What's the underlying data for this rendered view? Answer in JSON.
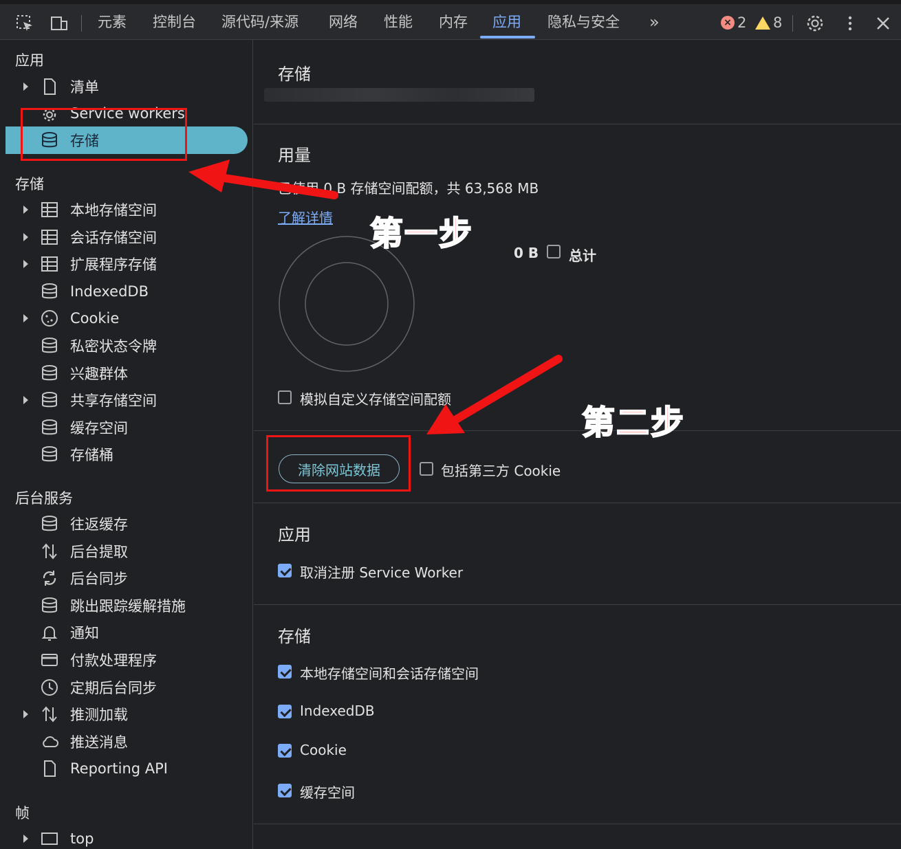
{
  "toolbar": {
    "tabs": [
      "元素",
      "控制台",
      "源代码/来源",
      "网络",
      "性能",
      "内存",
      "应用",
      "隐私与安全"
    ],
    "active_tab": "应用",
    "more_label": "»",
    "error_count": "2",
    "warning_count": "8",
    "colors": {
      "accent": "#7cacf8",
      "selected_bg": "#5fb4c9",
      "error": "#f28b82",
      "warning": "#fdd663"
    }
  },
  "sidebar": {
    "app_section": "应用",
    "app_items": [
      {
        "label": "清单",
        "icon": "file-icon"
      },
      {
        "label": "Service workers",
        "icon": "gear-icon"
      },
      {
        "label": "存储",
        "icon": "database-icon"
      }
    ],
    "storage_section": "存储",
    "storage_items": [
      {
        "label": "本地存储空间",
        "icon": "table-icon"
      },
      {
        "label": "会话存储空间",
        "icon": "table-icon"
      },
      {
        "label": "扩展程序存储",
        "icon": "table-icon"
      },
      {
        "label": "IndexedDB",
        "icon": "database-icon"
      },
      {
        "label": "Cookie",
        "icon": "cookie-icon"
      },
      {
        "label": "私密状态令牌",
        "icon": "database-icon"
      },
      {
        "label": "兴趣群体",
        "icon": "database-icon"
      },
      {
        "label": "共享存储空间",
        "icon": "database-icon"
      },
      {
        "label": "缓存空间",
        "icon": "database-icon"
      },
      {
        "label": "存储桶",
        "icon": "database-icon"
      }
    ],
    "bg_section": "后台服务",
    "bg_items": [
      {
        "label": "往返缓存",
        "icon": "database-icon"
      },
      {
        "label": "后台提取",
        "icon": "up-down-arrows-icon"
      },
      {
        "label": "后台同步",
        "icon": "sync-icon"
      },
      {
        "label": "跳出跟踪缓解措施",
        "icon": "database-icon"
      },
      {
        "label": "通知",
        "icon": "bell-icon"
      },
      {
        "label": "付款处理程序",
        "icon": "card-icon"
      },
      {
        "label": "定期后台同步",
        "icon": "clock-icon"
      },
      {
        "label": "推测加载",
        "icon": "up-down-arrows-icon"
      },
      {
        "label": "推送消息",
        "icon": "cloud-icon"
      },
      {
        "label": "Reporting API",
        "icon": "file-icon"
      }
    ],
    "frames_section": "帧",
    "frame_items": [
      {
        "label": "top",
        "icon": "window-icon"
      }
    ]
  },
  "main": {
    "title": "存储",
    "usage_title": "用量",
    "usage_text": "已使用 0 B 存储空间配额，共 63,568 MB",
    "learn_more": "了解详情",
    "legend_value": "0 B",
    "legend_label": "总计",
    "simulate_quota": "模拟自定义存储空间配额",
    "clear_button": "清除网站数据",
    "include_third_party": "包括第三方 Cookie",
    "app_title": "应用",
    "unregister_sw": "取消注册 Service Worker",
    "storage_title": "存储",
    "storage_checks": [
      "本地存储空间和会话存储空间",
      "IndexedDB",
      "Cookie",
      "缓存空间"
    ]
  },
  "annotations": {
    "step1": "第一步",
    "step2": "第二步"
  }
}
